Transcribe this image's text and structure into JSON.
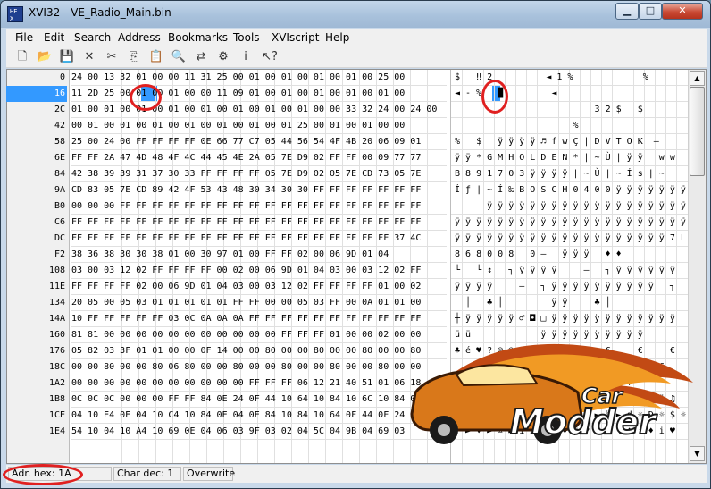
{
  "window": {
    "title": "XVI32 - VE_Radio_Main.bin",
    "app_icon_text": "HE X",
    "min_glyph": "▁",
    "max_glyph": "□",
    "close_glyph": "✕"
  },
  "menu": [
    "File",
    "Edit",
    "Search",
    "Address",
    "Bookmarks",
    "Tools",
    "XVIscript",
    "Help"
  ],
  "toolbar_icons": [
    {
      "name": "new-file-icon",
      "glyph": "🗋"
    },
    {
      "name": "open-folder-icon",
      "glyph": "📂"
    },
    {
      "name": "save-icon",
      "glyph": "💾"
    },
    {
      "name": "delete-icon",
      "glyph": "✕"
    },
    {
      "name": "cut-icon",
      "glyph": "✂"
    },
    {
      "name": "copy-icon",
      "glyph": "⎘"
    },
    {
      "name": "paste-icon",
      "glyph": "📋"
    },
    {
      "name": "find-icon",
      "glyph": "🔍"
    },
    {
      "name": "replace-icon",
      "glyph": "⇄"
    },
    {
      "name": "settings-icon",
      "glyph": "⚙"
    },
    {
      "name": "info-icon",
      "glyph": "ⅰ"
    },
    {
      "name": "help-icon",
      "glyph": "↖?"
    }
  ],
  "addresses": [
    "0",
    "16",
    "2C",
    "42",
    "58",
    "6E",
    "84",
    "9A",
    "B0",
    "C6",
    "DC",
    "F2",
    "108",
    "11E",
    "134",
    "14A",
    "160",
    "176",
    "18C",
    "1A2",
    "1B8",
    "1CE",
    "1E4"
  ],
  "selected_address_index": 1,
  "hex_rows": [
    "24 00 13 32 01 00 00 11 31 25 00 01 00 01 00 01 00 01 00 25 00",
    "11 2D 25 00 01 00 01 00 00 11 09 01 00 01 00 01 00 01 00 01 00",
    "01 00 01 00 01 00 01 00 01 00 01 00 01 00 01 00 00 33 32 24 00 24 00",
    "00 01 00 01 00 01 00 01 00 01 00 01 00 01 25 00 01 00 01 00 00",
    "25 00 24 00 FF FF FF FF 0E 66 77 C7 05 44 56 54 4F 4B 20 06 09 01",
    "FF FF 2A 47 4D 48 4F 4C 44 45 4E 2A 05 7E D9 02 FF FF 00 09 77 77",
    "42 38 39 39 31 37 30 33 FF FF FF FF 05 7E D9 02 05 7E CD 73 05 7E",
    "CD 83 05 7E CD 89 42 4F 53 43 48 30 34 30 30 FF FF FF FF FF FF FF",
    "00 00 00 FF FF FF FF FF FF FF FF FF FF FF FF FF FF FF FF FF FF FF",
    "FF FF FF FF FF FF FF FF FF FF FF FF FF FF FF FF FF FF FF FF FF FF",
    "FF FF FF FF FF FF FF FF FF FF FF FF FF FF FF FF FF FF FF FF 37 4C",
    "38 36 38 30 30 38 01 00 30 97 01 00 FF FF 02 00 06 9D 01 04",
    "03 00 03 12 02 FF FF FF FF 00 02 00 06 9D 01 04 03 00 03 12 02 FF",
    "FF FF FF FF 02 00 06 9D 01 04 03 00 03 12 02 FF FF FF FF 01 00 02",
    "20 05 00 05 03 01 01 01 01 01 FF FF 00 00 05 03 FF 00 0A 01 01 00",
    "10 FF FF FF FF FF 03 0C 0A 0A 0A FF FF FF FF FF FF FF FF FF FF FF",
    "81 81 00 00 00 00 00 00 00 00 00 00 00 FF FF FF 01 00 00 02 00 00",
    "05 82 03 3F 01 01 00 00 0F 14 00 00 80 00 00 80 00 00 80 00 00 80",
    "00 00 80 00 00 80 06 80 00 00 80 00 00 80 00 00 80 00 00 80 00 00",
    "00 00 00 00 00 00 00 00 00 00 00 FF FF FF 06 12 21 40 51 01 06 18",
    "0C 0C 0C 00 00 00 FF FF 84 0E 24 0F 44 10 64 10 84 10 6C 10 84 0E",
    "04 10 E4 0E 04 10 C4 10 84 0E 04 0E 84 10 84 10 64 0F 44 0F 24 0F",
    "54 10 04 10 A4 10 69 0E 04 06 03 9F 03 02 04 5C 04 9B 04 69 03"
  ],
  "char_rows": [
    "$   ‼ 2          ◄ 1 %             %",
    "◄ - %   █         ◄",
    "                          3 2 $   $",
    "                      %",
    "%   $   ÿ ÿ ÿ ÿ ♬ f w Ç | D V T O K  –",
    "ÿ ÿ * G M H O L D E N * | ~ Ù | ÿ ÿ   w w",
    "B 8 9 1 7 0 3 ÿ ÿ ÿ ÿ | ~ Ù | ~ Í s | ~",
    "Í ƒ | ~ Í ‰ B O S C H 0 4 0 0 ÿ ÿ ÿ ÿ ÿ ÿ ÿ",
    "      ÿ ÿ ÿ ÿ ÿ ÿ ÿ ÿ ÿ ÿ ÿ ÿ ÿ ÿ ÿ ÿ ÿ ÿ ÿ",
    "ÿ ÿ ÿ ÿ ÿ ÿ ÿ ÿ ÿ ÿ ÿ ÿ ÿ ÿ ÿ ÿ ÿ ÿ ÿ ÿ ÿ ÿ",
    "ÿ ÿ ÿ ÿ ÿ ÿ ÿ ÿ ÿ ÿ ÿ ÿ ÿ ÿ ÿ ÿ ÿ ÿ ÿ ÿ 7 L",
    "8 6 8 0 0 8   0 –   ÿ ÿ ÿ   ♦ ♦",
    "└   └ ↕   ┐ ÿ ÿ ÿ ÿ     –   ┐ ÿ ÿ ÿ ÿ ÿ ÿ",
    "ÿ ÿ ÿ ÿ     –   ┐ ÿ ÿ ÿ ÿ ÿ ÿ ÿ ÿ ÿ ÿ   ┐",
    "  │   ♣ │         ÿ ÿ     ♣ │",
    "┼ ÿ ÿ ÿ ÿ ÿ ♂ ◘ □ ÿ ÿ ÿ ÿ ÿ ÿ ÿ ÿ ÿ ÿ ÿ ÿ",
    "ü ü             ÿ ÿ ÿ ÿ ÿ ÿ ÿ ÿ ÿ ÿ",
    "♣ é ♥ ? ☺ ☺   ☼ ¶     €     €     €     €",
    "    €     € ♠ €     €     €     €     €",
    "            ÿ ÿ ÿ ♠ ‼ ! @ Q ☺ ♠ ↑",
    "♀ ♀ ♀     ÿ ÿ ä ♫ $ ☼ D ► d ► ä ► l ► ä ♫",
    "♦ ► ä ♫ ♦ ► Ä ► ä ♫ ♦ ♫ ä ► ä ► d ☼ D ☼ $ ☼",
    "T ► ♦ ► ¤ ► i ♫ ♦ ♠ ♥ ƒ ♥ ☻ ♦ \\ ♦ › ♦ i ♥"
  ],
  "status": {
    "address": "Adr. hex: 1A",
    "char_dec": "Char dec: 1",
    "mode": "Overwrite"
  },
  "watermark": {
    "line1": "Car",
    "line2": "Modder"
  }
}
